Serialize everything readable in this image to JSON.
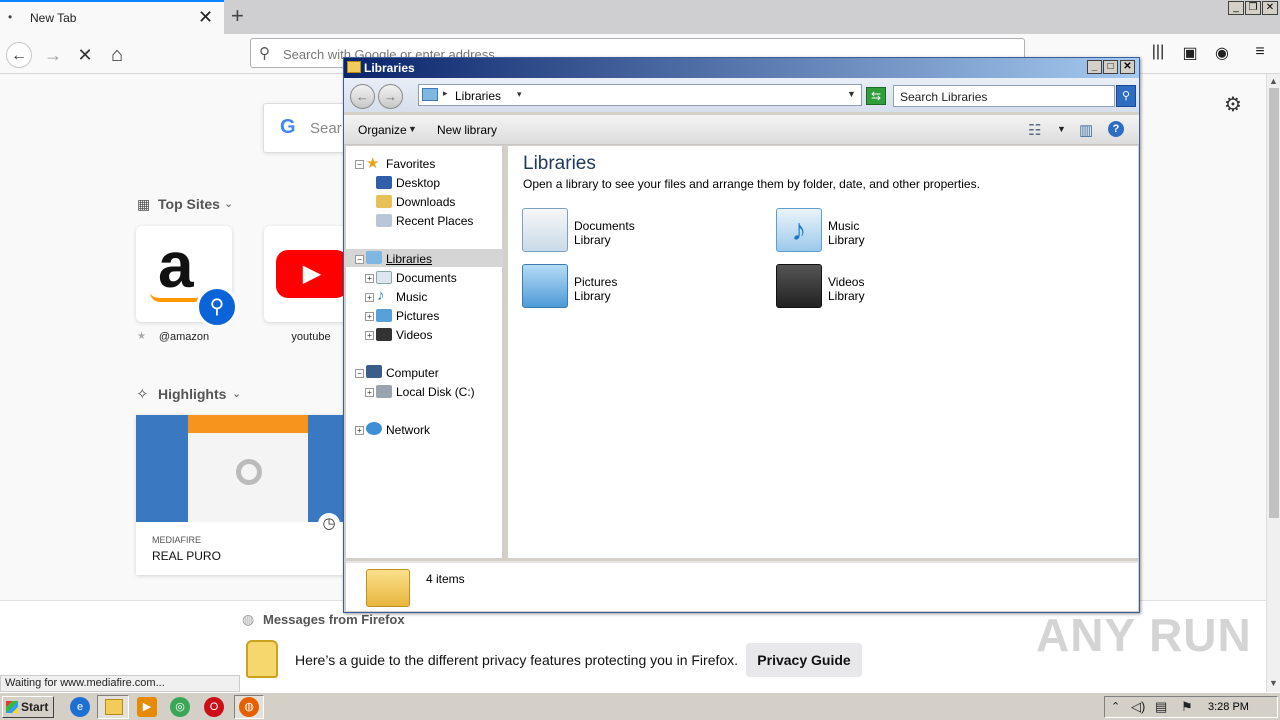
{
  "browser": {
    "tab_title": "New Tab",
    "tab_dot": "•",
    "tab_close": "✕",
    "new_tab": "+",
    "url_placeholder": "Search with Google or enter address",
    "back": "←",
    "forward": "→",
    "stop": "✕",
    "home": "⌂",
    "status_text": "Waiting for www.mediafire.com..."
  },
  "newtab": {
    "google_search_placeholder": "Sear",
    "google_letter": "G",
    "top_sites_heading": "Top Sites",
    "top_sites": [
      {
        "label": "@amazon",
        "logo_text": "a"
      },
      {
        "label": "youtube",
        "logo_text": "▶"
      }
    ],
    "highlights_heading": "Highlights",
    "highlight": {
      "source": "MEDIAFIRE",
      "title": "REAL PURO"
    },
    "messages_heading": "Messages from Firefox",
    "message_text": "Here’s a guide to the different privacy features protecting you in Firefox.",
    "privacy_button": "Privacy Guide",
    "watermark": "ANY RUN"
  },
  "explorer": {
    "title": "Libraries",
    "address_text": "Libraries",
    "search_placeholder": "Search Libraries",
    "toolbar": {
      "organize": "Organize",
      "new_library": "New library"
    },
    "nav": {
      "favorites": "Favorites",
      "desktop": "Desktop",
      "downloads": "Downloads",
      "recent": "Recent Places",
      "libraries": "Libraries",
      "documents": "Documents",
      "music": "Music",
      "pictures": "Pictures",
      "videos": "Videos",
      "computer": "Computer",
      "local_disk": "Local Disk (C:)",
      "network": "Network"
    },
    "heading": "Libraries",
    "subheading": "Open a library to see your files and arrange them by folder, date, and other properties.",
    "libraries": [
      {
        "name": "Documents",
        "kind": "Library",
        "icon": "documents-icon"
      },
      {
        "name": "Music",
        "kind": "Library",
        "icon": "music-icon"
      },
      {
        "name": "Pictures",
        "kind": "Library",
        "icon": "pictures-icon"
      },
      {
        "name": "Videos",
        "kind": "Library",
        "icon": "videos-icon"
      }
    ],
    "status_count": "4 items"
  },
  "taskbar": {
    "start_label": "Start",
    "clock": "3:28 PM"
  },
  "colors": {
    "accent": "#0a84ff",
    "explorer_title": "#0a246a",
    "amazon_orange": "#f90",
    "youtube_red": "#ff0000"
  }
}
